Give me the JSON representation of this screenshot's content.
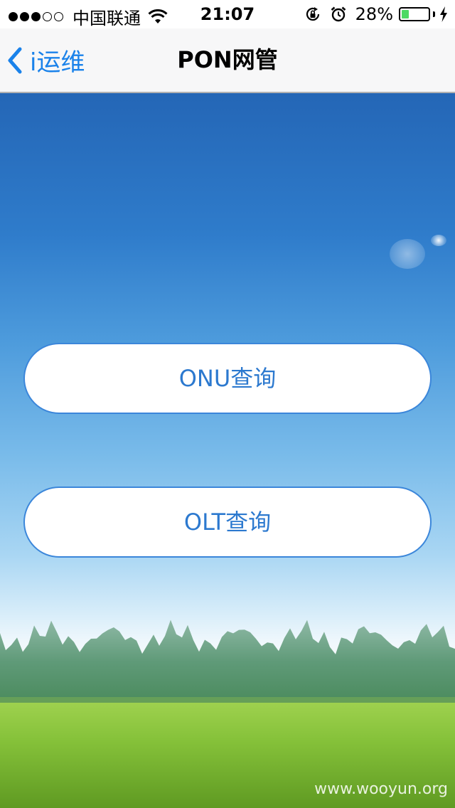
{
  "status_bar": {
    "signal_bars_filled": 3,
    "signal_bars_total": 5,
    "carrier": "中国联通",
    "time": "21:07",
    "battery_percent": "28%",
    "battery_level": 0.28,
    "icons": [
      "wifi-icon",
      "rotation-lock-icon",
      "alarm-icon",
      "battery-icon",
      "charging-bolt-icon"
    ]
  },
  "nav": {
    "back_label": "i运维",
    "title": "PON网管"
  },
  "buttons": {
    "onu": "ONU查询",
    "olt": "OLT查询"
  },
  "watermark": "www.wooyun.org",
  "colors": {
    "accent": "#2c79cf",
    "back_link": "#1a82ea",
    "battery": "#4cd964"
  }
}
